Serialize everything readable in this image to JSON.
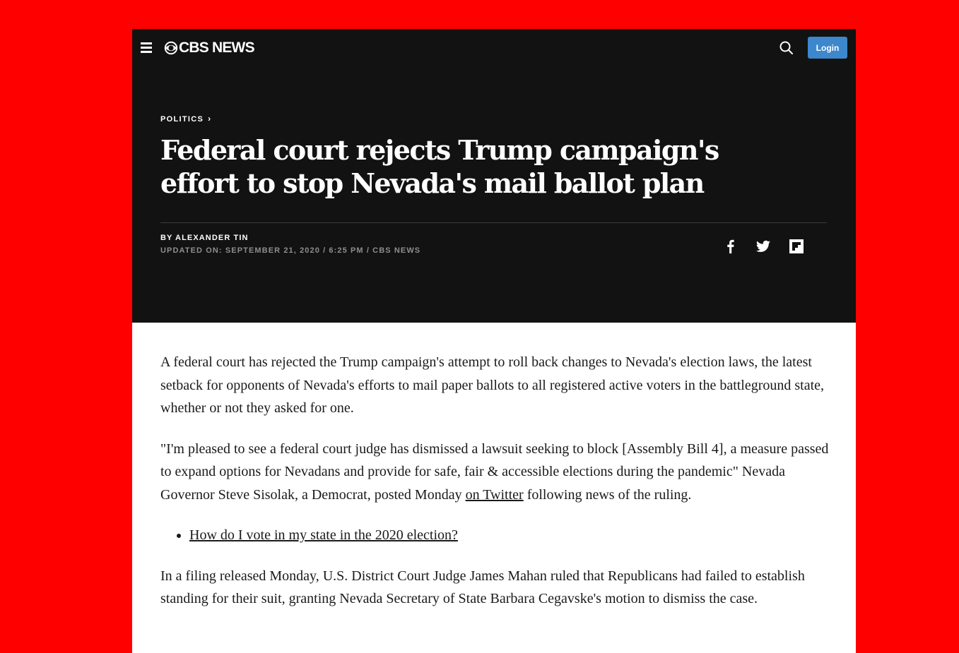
{
  "header": {
    "brand": "CBS NEWS",
    "login_label": "Login"
  },
  "article": {
    "section": "POLITICS",
    "section_chevron": "›",
    "title": "Federal court rejects Trump campaign's effort to stop Nevada's mail ballot plan",
    "byline": "BY ALEXANDER TIN",
    "updated": "UPDATED ON: SEPTEMBER 21, 2020 / 6:25 PM / CBS NEWS",
    "share_icons": [
      "facebook-icon",
      "twitter-icon",
      "flipboard-icon"
    ],
    "paragraph1": "A federal court has rejected the Trump campaign's attempt to roll back changes to Nevada's election laws, the latest setback for opponents of Nevada's efforts to mail paper ballots to all registered active voters in the battleground state, whether or not they asked for one.",
    "paragraph2_before_link": "\"I'm pleased to see a federal court judge has dismissed a lawsuit seeking to block [Assembly Bill 4], a measure passed to expand options for Nevadans and provide for safe, fair & accessible elections during the pandemic\" Nevada Governor Steve Sisolak, a Democrat, posted Monday ",
    "paragraph2_link": "on Twitter",
    "paragraph2_after_link": " following news of the ruling.",
    "related_link": "How do I vote in my state in the 2020 election?",
    "paragraph3": "In a filing released Monday, U.S. District Court Judge James Mahan ruled that Republicans had failed to establish standing for their suit, granting Nevada Secretary of State Barbara Cegavske's motion to dismiss the case."
  },
  "colors": {
    "background": "#ff0000",
    "hero": "#121212",
    "login_button": "#3d87cc"
  }
}
